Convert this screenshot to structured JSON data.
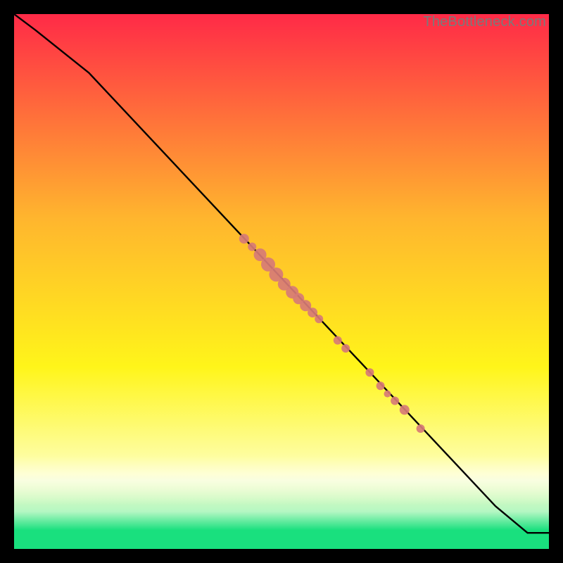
{
  "watermark": "TheBottleneck.com",
  "colors": {
    "red": "#ff2a47",
    "orange": "#ffb52e",
    "yellow": "#fff51a",
    "paleYellow": "#feffba",
    "paleGreen": "#b5f7c3",
    "green": "#19e07e",
    "line": "#000000",
    "marker": "#d77b76",
    "black": "#000000"
  },
  "chart_data": {
    "type": "line",
    "title": "",
    "xlabel": "",
    "ylabel": "",
    "xlim": [
      0,
      100
    ],
    "ylim": [
      0,
      100
    ],
    "grid": false,
    "series": [
      {
        "name": "main-curve",
        "x": [
          0,
          4,
          9,
          14,
          90,
          96,
          100
        ],
        "y": [
          100,
          97,
          93,
          89,
          8,
          3,
          3
        ]
      }
    ],
    "markers": {
      "name": "highlight-points",
      "color": "#d77b76",
      "points": [
        {
          "x": 43.0,
          "y": 58.0,
          "r": 7
        },
        {
          "x": 44.5,
          "y": 56.5,
          "r": 6
        },
        {
          "x": 46.0,
          "y": 55.0,
          "r": 9
        },
        {
          "x": 47.5,
          "y": 53.2,
          "r": 10
        },
        {
          "x": 49.0,
          "y": 51.3,
          "r": 10
        },
        {
          "x": 50.5,
          "y": 49.5,
          "r": 9
        },
        {
          "x": 52.0,
          "y": 48.0,
          "r": 9
        },
        {
          "x": 53.2,
          "y": 46.8,
          "r": 8
        },
        {
          "x": 54.5,
          "y": 45.5,
          "r": 8
        },
        {
          "x": 55.8,
          "y": 44.2,
          "r": 7
        },
        {
          "x": 57.0,
          "y": 43.0,
          "r": 6
        },
        {
          "x": 60.5,
          "y": 39.0,
          "r": 6
        },
        {
          "x": 62.0,
          "y": 37.5,
          "r": 6
        },
        {
          "x": 66.5,
          "y": 33.0,
          "r": 6
        },
        {
          "x": 68.5,
          "y": 30.5,
          "r": 6
        },
        {
          "x": 69.8,
          "y": 29.0,
          "r": 5
        },
        {
          "x": 71.2,
          "y": 27.7,
          "r": 6
        },
        {
          "x": 73.0,
          "y": 26.0,
          "r": 7
        },
        {
          "x": 76.0,
          "y": 22.5,
          "r": 6
        }
      ]
    },
    "background_gradient": {
      "stops": [
        {
          "pos": 0.0,
          "color": "#ff2a47"
        },
        {
          "pos": 0.38,
          "color": "#ffb52e"
        },
        {
          "pos": 0.66,
          "color": "#fff51a"
        },
        {
          "pos": 0.86,
          "color": "#feffba"
        },
        {
          "pos": 0.93,
          "color": "#b5f7c3"
        },
        {
          "pos": 0.965,
          "color": "#19e07e"
        },
        {
          "pos": 1.0,
          "color": "#19e07e"
        }
      ]
    }
  }
}
